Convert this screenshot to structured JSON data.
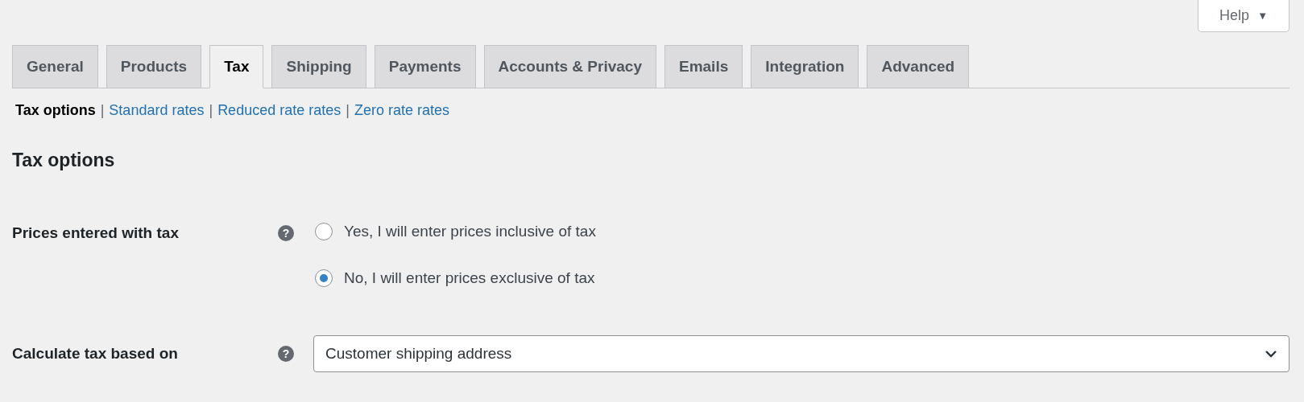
{
  "help_button": {
    "label": "Help",
    "caret": "▼"
  },
  "tabs": [
    {
      "label": "General",
      "selected": false
    },
    {
      "label": "Products",
      "selected": false
    },
    {
      "label": "Tax",
      "selected": true
    },
    {
      "label": "Shipping",
      "selected": false
    },
    {
      "label": "Payments",
      "selected": false
    },
    {
      "label": "Accounts & Privacy",
      "selected": false
    },
    {
      "label": "Emails",
      "selected": false
    },
    {
      "label": "Integration",
      "selected": false
    },
    {
      "label": "Advanced",
      "selected": false
    }
  ],
  "subnav": [
    {
      "label": "Tax options",
      "selected": true
    },
    {
      "separator": "|",
      "label": "Standard rates",
      "selected": false
    },
    {
      "separator": "|",
      "label": "Reduced rate rates",
      "selected": false
    },
    {
      "separator": "|",
      "label": "Zero rate rates",
      "selected": false
    }
  ],
  "section_title": "Tax options",
  "settings": [
    {
      "kind": "radio",
      "label": "Prices entered with tax",
      "help": "?",
      "options": [
        {
          "label": "Yes, I will enter prices inclusive of tax",
          "selected": false
        },
        {
          "label": "No, I will enter prices exclusive of tax",
          "selected": true
        }
      ]
    },
    {
      "kind": "select",
      "label": "Calculate tax based on",
      "help": "?",
      "value": "Customer shipping address"
    }
  ]
}
